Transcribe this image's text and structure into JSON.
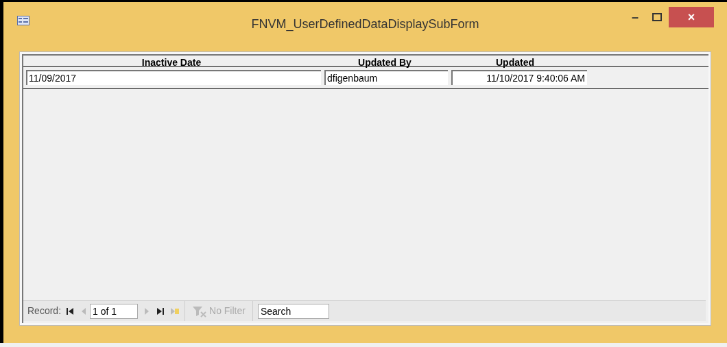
{
  "window": {
    "title": "FNVM_UserDefinedDataDisplaySubForm",
    "controls": [
      "–",
      "×"
    ]
  },
  "columns": [
    "Inactive Date",
    "Updated By",
    "Updated"
  ],
  "rows": [
    {
      "inactive_date": "11/09/2017",
      "updated_by": "dfigenbaum",
      "updated": "11/10/2017 9:40:06 AM"
    }
  ],
  "navigation": {
    "label": "Record:",
    "position": "1 of 1",
    "buttons": [
      {
        "kind": "first",
        "disabled": false
      },
      {
        "kind": "previous",
        "disabled": true
      },
      {
        "kind": "next",
        "disabled": true
      },
      {
        "kind": "last",
        "disabled": false
      },
      {
        "kind": "new",
        "disabled": true
      }
    ],
    "filter": {
      "label": "No Filter",
      "disabled": true
    },
    "search": {
      "placeholder": "Search"
    }
  }
}
